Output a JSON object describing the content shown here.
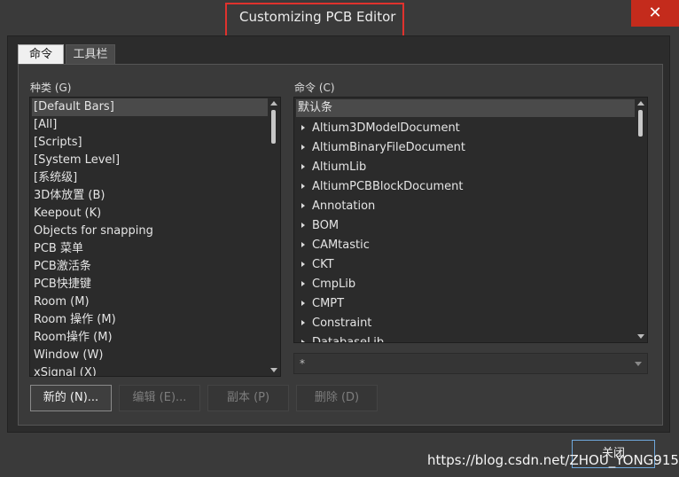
{
  "window": {
    "title": "Customizing PCB Editor",
    "close_glyph": "✕"
  },
  "tabs": [
    {
      "label": "命令"
    },
    {
      "label": "工具栏"
    }
  ],
  "categories": {
    "label": "种类 (G)",
    "items": [
      "[Default Bars]",
      "[All]",
      "[Scripts]",
      "[System Level]",
      "[系统级]",
      "3D体放置 (B)",
      "Keepout (K)",
      "Objects for snapping",
      "PCB 菜单",
      "PCB激活条",
      "PCB快捷键",
      "Room (M)",
      "Room 操作 (M)",
      "Room操作 (M)",
      "Window (W)",
      "xSignal (X)"
    ],
    "selected_index": 0
  },
  "commands": {
    "label": "命令 (C)",
    "header": "默认条",
    "items": [
      "Altium3DModelDocument",
      "AltiumBinaryFileDocument",
      "AltiumLib",
      "AltiumPCBBlockDocument",
      "Annotation",
      "BOM",
      "CAMtastic",
      "CKT",
      "CmpLib",
      "CMPT",
      "Constraint",
      "DatabaseLib"
    ]
  },
  "filter": {
    "value": "*"
  },
  "buttons": {
    "new": "新的 (N)...",
    "edit": "编辑 (E)...",
    "copy": "副本 (P)",
    "delete": "删除 (D)",
    "close": "关闭"
  },
  "watermark": "https://blog.csdn.net/ZHOU_YONG915",
  "colors": {
    "highlight_border": "#e0322d",
    "close_bg": "#c42b1c",
    "close_button_border": "#6fa8dc"
  }
}
